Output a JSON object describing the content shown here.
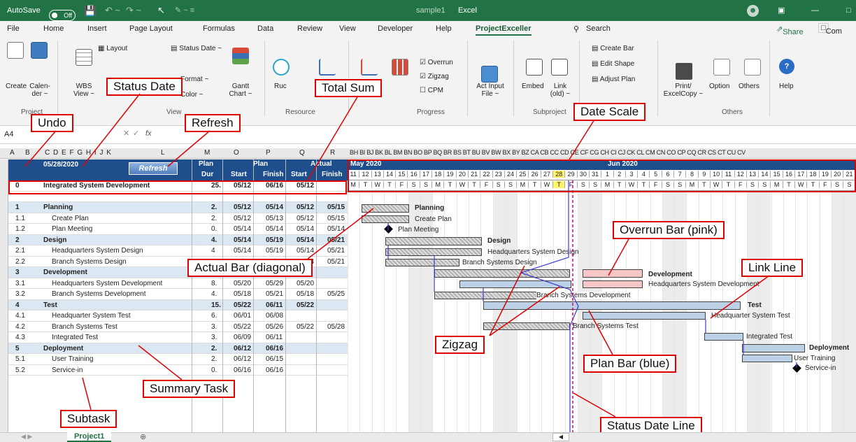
{
  "titlebar": {
    "autosave": "AutoSave",
    "autosave_state": "Off",
    "filename": "sample1",
    "app": "Excel",
    "share": "Share",
    "comments": "Com"
  },
  "tabs": [
    "File",
    "Home",
    "Insert",
    "Page Layout",
    "Formulas",
    "Data",
    "Review",
    "View",
    "Developer",
    "Help",
    "ProjectExceller"
  ],
  "search": "Search",
  "ribbon": {
    "create": "Create",
    "calender": "Calen-\nder ~",
    "wbs": "WBS\nView ~",
    "layout": "Layout",
    "status_date_btn": "Status Date ~",
    "format": "Format ~",
    "color": "Color ~",
    "gantt": "Gantt\nChart ~",
    "ruc": "Ruc",
    "overrun": "Overrun",
    "zigzag": "Zigzag",
    "cpm": "CPM",
    "act_input": "Act Input\nFile ~",
    "embed": "Embed",
    "link": "Link\n(old) ~",
    "create_bar": "Create Bar",
    "edit_shape": "Edit Shape",
    "adjust_plan": "Adjust Plan",
    "print": "Print/\nExcelCopy ~",
    "option": "Option",
    "others_btn": "Others",
    "help": "Help",
    "groups": [
      "Project",
      "View",
      "Resource",
      "Progress",
      "Subproject",
      "Others"
    ]
  },
  "formula_bar": {
    "cell_ref": "A4",
    "fx": "fx"
  },
  "column_headers": [
    "A",
    "B",
    "C D E F G H I J K",
    "L",
    "M",
    "O",
    "P",
    "Q",
    "R"
  ],
  "date_col_header": "BH BI BJ BK BL BM BN BO BP BQ BR BS BT BU BV BW BX BY BZ CA CB CC CD CE CF CG CH CI CJ CK CL CM CN CO CP CQ CR CS CT CU CV",
  "sheet": {
    "status_date": "05/28/2020",
    "refresh": "Refresh",
    "headers": {
      "plan_dur": "Plan",
      "plan_dur2": "Dur",
      "plan": "Plan",
      "actual": "Actual",
      "start": "Start",
      "finish": "Finish"
    },
    "months": [
      "May 2020",
      "Jun 2020"
    ],
    "days": [
      11,
      12,
      13,
      14,
      15,
      16,
      17,
      18,
      19,
      20,
      21,
      22,
      23,
      24,
      25,
      26,
      27,
      28,
      29,
      30,
      31,
      1,
      2,
      3,
      4,
      5,
      6,
      7,
      8,
      9,
      10,
      11,
      12,
      13,
      14,
      15,
      16,
      17,
      18,
      19,
      20,
      21
    ],
    "weekdays": [
      "M",
      "T",
      "W",
      "T",
      "F",
      "S",
      "S",
      "M",
      "T",
      "W",
      "T",
      "F",
      "S",
      "S",
      "M",
      "T",
      "W",
      "T",
      "F",
      "S",
      "S",
      "M",
      "T",
      "W",
      "T",
      "F",
      "S",
      "S",
      "M",
      "T",
      "W",
      "T",
      "F",
      "S",
      "S",
      "M",
      "T",
      "W",
      "T",
      "F",
      "S",
      "S"
    ],
    "rows": [
      {
        "r": "3",
        "id": "0",
        "name": "Integrated System Development",
        "dur": "25.",
        "ps": "05/12",
        "pf": "06/16",
        "as": "05/12",
        "af": "",
        "type": "top"
      },
      {
        "r": "3",
        "id": "",
        "name": "",
        "dur": "",
        "ps": "",
        "pf": "",
        "as": "",
        "af": "",
        "type": "blank"
      },
      {
        "r": "4",
        "id": "1",
        "name": "Planning",
        "dur": "2.",
        "ps": "05/12",
        "pf": "05/14",
        "as": "05/12",
        "af": "05/15",
        "type": "sum"
      },
      {
        "r": "5",
        "id": "1.1",
        "name": "Create Plan",
        "dur": "2.",
        "ps": "05/12",
        "pf": "05/13",
        "as": "05/12",
        "af": "05/15",
        "type": "task"
      },
      {
        "r": "6",
        "id": "1.2",
        "name": "Plan Meeting",
        "dur": "0.",
        "ps": "05/14",
        "pf": "05/14",
        "as": "05/14",
        "af": "05/14",
        "type": "task"
      },
      {
        "r": "7",
        "id": "2",
        "name": "Design",
        "dur": "4.",
        "ps": "05/14",
        "pf": "05/19",
        "as": "05/14",
        "af": "05/21",
        "type": "sum"
      },
      {
        "r": "8",
        "id": "2.1",
        "name": "Headquarters System Design",
        "dur": "4",
        "ps": "05/14",
        "pf": "05/19",
        "as": "05/14",
        "af": "05/21",
        "type": "task"
      },
      {
        "r": "9",
        "id": "2.2",
        "name": "Branch Systems Design",
        "dur": "4",
        "ps": "05/14",
        "pf": "05/19",
        "as": "05/14",
        "af": "05/21",
        "type": "task"
      },
      {
        "r": "10",
        "id": "3",
        "name": "Development",
        "dur": "",
        "ps": "",
        "pf": "",
        "as": "",
        "af": "",
        "type": "sum"
      },
      {
        "r": "11",
        "id": "3.1",
        "name": "Headquarters System Development",
        "dur": "8.",
        "ps": "05/20",
        "pf": "05/29",
        "as": "05/20",
        "af": "",
        "type": "task"
      },
      {
        "r": "12",
        "id": "3.2",
        "name": "Branch Systems Development",
        "dur": "4.",
        "ps": "05/18",
        "pf": "05/21",
        "as": "05/18",
        "af": "05/25",
        "type": "task"
      },
      {
        "r": "13",
        "id": "4",
        "name": "Test",
        "dur": "15.",
        "ps": "05/22",
        "pf": "06/11",
        "as": "05/22",
        "af": "",
        "type": "sum"
      },
      {
        "r": "14",
        "id": "4.1",
        "name": "Headquarter System Test",
        "dur": "6.",
        "ps": "06/01",
        "pf": "06/08",
        "as": "",
        "af": "",
        "type": "task"
      },
      {
        "r": "15",
        "id": "4.2",
        "name": "Branch Systems Test",
        "dur": "3.",
        "ps": "05/22",
        "pf": "05/26",
        "as": "05/22",
        "af": "05/28",
        "type": "task"
      },
      {
        "r": "16",
        "id": "4.3",
        "name": "Integrated Test",
        "dur": "3.",
        "ps": "06/09",
        "pf": "06/11",
        "as": "",
        "af": "",
        "type": "task"
      },
      {
        "r": "17",
        "id": "5",
        "name": "Deployment",
        "dur": "2.",
        "ps": "06/12",
        "pf": "06/16",
        "as": "",
        "af": "",
        "type": "sum"
      },
      {
        "r": "18",
        "id": "5.1",
        "name": "User Training",
        "dur": "2.",
        "ps": "06/12",
        "pf": "06/15",
        "as": "",
        "af": "",
        "type": "task"
      },
      {
        "r": "19",
        "id": "5.2",
        "name": "Service-in",
        "dur": "0.",
        "ps": "06/16",
        "pf": "06/16",
        "as": "",
        "af": "",
        "type": "task"
      }
    ]
  },
  "gantt_labels": {
    "planning": "Planning",
    "create_plan": "Create Plan",
    "plan_meeting": "Plan Meeting",
    "design": "Design",
    "hq_design": "Headquarters System Design",
    "br_design": "Branch Systems Design",
    "development": "Development",
    "hq_dev": "Headquarters System Development",
    "br_dev": "Branch Systems Development",
    "test": "Test",
    "hq_test": "Headquarter System Test",
    "br_test": "Branch Systems Test",
    "int_test": "Integrated Test",
    "deployment": "Deployment",
    "training": "User Training",
    "service": "Service-in"
  },
  "callouts": {
    "undo": "Undo",
    "status_date": "Status Date",
    "refresh": "Refresh",
    "total_sum": "Total Sum",
    "date_scale": "Date Scale",
    "overrun": "Overrun Bar (pink)",
    "actual": "Actual Bar (diagonal)",
    "link": "Link Line",
    "zigzag": "Zigzag",
    "plan": "Plan Bar (blue)",
    "summary": "Summary Task",
    "subtask": "Subtask",
    "status_line": "Status Date Line"
  },
  "sheet_tab": "Project1",
  "colors": {
    "excel_green": "#217346",
    "summary_bg": "#dbe8f3",
    "date_header": "#1f4e8c",
    "callout": "#e00000",
    "plan_bar": "#bcd0e6",
    "overrun_bar": "#f7c7c7",
    "status_line": "#d9007a"
  }
}
